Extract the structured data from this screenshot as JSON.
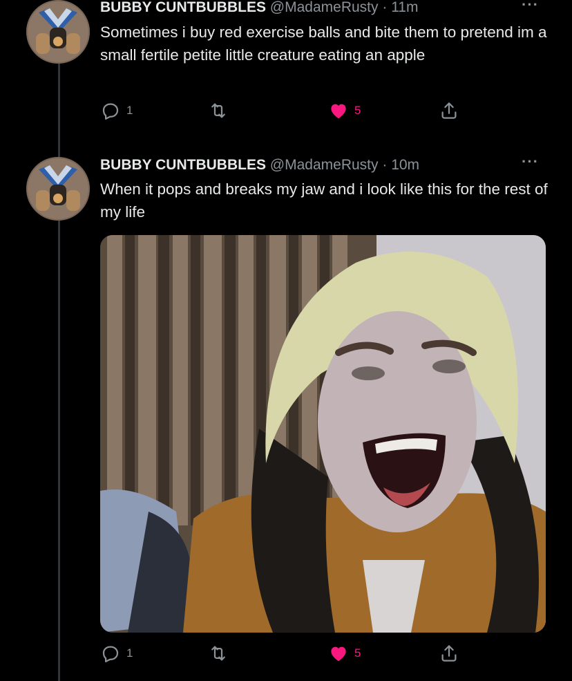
{
  "tweets": [
    {
      "author_name": "BUBBY CUNTBUBBLES",
      "handle": "@MadameRusty",
      "separator": "·",
      "time": "11m",
      "more_glyph": "···",
      "text": "Sometimes i buy red exercise balls and bite them to pretend im a small fertile petite little creature eating an apple",
      "reply_count": "1",
      "like_count": "5"
    },
    {
      "author_name": "BUBBY CUNTBUBBLES",
      "handle": "@MadameRusty",
      "separator": "·",
      "time": "10m",
      "more_glyph": "···",
      "text": "When it pops and breaks my jaw and i look like this for the rest of my life",
      "reply_count": "1",
      "like_count": "5"
    }
  ],
  "icons": {
    "reply": "reply-icon",
    "retweet": "retweet-icon",
    "like": "heart-icon",
    "share": "share-icon"
  },
  "colors": {
    "background": "#000000",
    "text": "#e7e9ea",
    "muted": "#8b9298",
    "like_active": "#f91880"
  }
}
